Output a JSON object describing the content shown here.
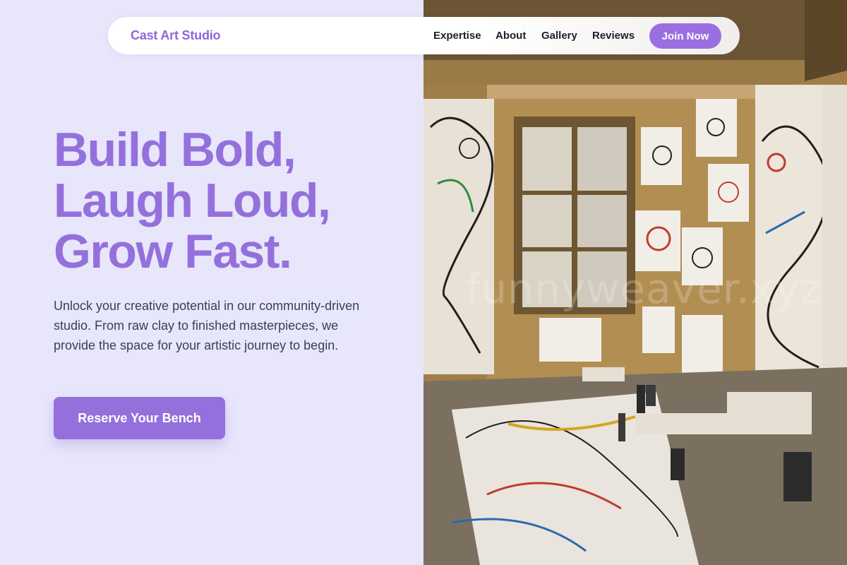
{
  "nav": {
    "brand": "Cast Art Studio",
    "links": [
      "Expertise",
      "About",
      "Gallery",
      "Reviews"
    ],
    "cta": "Join Now"
  },
  "hero": {
    "headline_lines": [
      "Build Bold,",
      "Laugh Loud,",
      "Grow Fast."
    ],
    "lede": "Unlock your creative potential in our community-driven studio. From raw clay to finished masterpieces, we provide the space for your artistic journey to begin.",
    "cta": "Reserve Your Bench"
  },
  "image": {
    "watermark": "funnyweaver.xyz"
  },
  "colors": {
    "accent": "#9470dc",
    "background": "#e8e6fb",
    "text_dark": "#1f1f2b",
    "body_text": "#3a3f55"
  },
  "icons": []
}
